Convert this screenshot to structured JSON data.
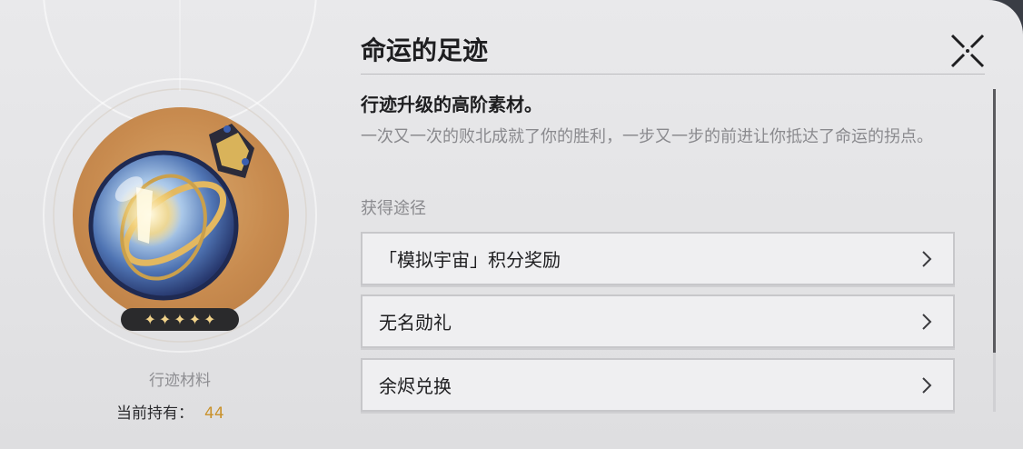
{
  "item": {
    "title": "命运的足迹",
    "rarity_stars": 5,
    "star_glyph": "✦",
    "category": "行迹材料",
    "owned_label": "当前持有：",
    "owned_count": "44"
  },
  "detail": {
    "subtitle": "行迹升级的高阶素材。",
    "description": "一次又一次的败北成就了你的胜利，一步又一步的前进让你抵达了命运的拐点。",
    "sources_heading": "获得途径",
    "sources": [
      {
        "label": "「模拟宇宙」积分奖励"
      },
      {
        "label": "无名勋礼"
      },
      {
        "label": "余烬兑换"
      }
    ]
  },
  "colors": {
    "accent_gold": "#c9922c",
    "orb_bg": "#c88b4f",
    "star": "#f2d38a"
  },
  "icons": {
    "close": "close-x-icon",
    "chevron": "chevron-right-icon",
    "item": "crystal-orb-item-icon"
  }
}
